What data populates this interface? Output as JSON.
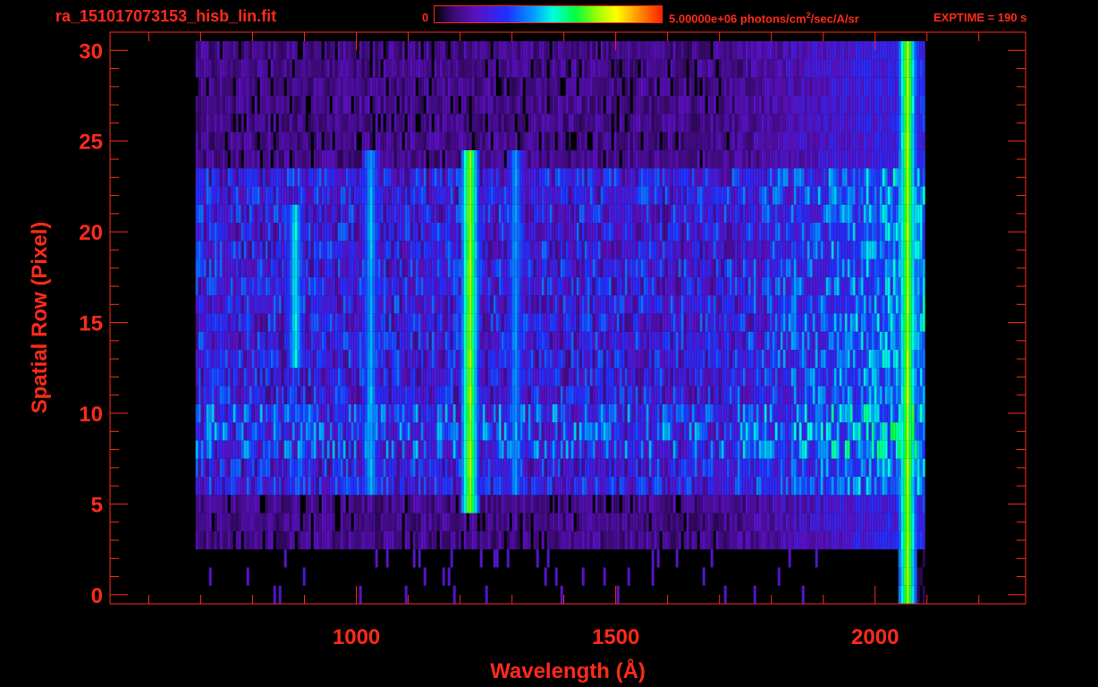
{
  "header": {
    "filename": "ra_151017073153_hisb_lin.fit",
    "colorbar_min_label": "0",
    "colorbar_max_label_prefix": "5.00000e+06 photons/cm",
    "colorbar_max_label_sup": "2",
    "colorbar_max_label_suffix": "/sec/A/sr",
    "exptime_label": "EXPTIME = 190 s"
  },
  "colors": {
    "axis": "#ff2a1a",
    "background": "#000000"
  },
  "chart_data": {
    "type": "heatmap",
    "title": "",
    "xlabel": "Wavelength (Å)",
    "ylabel": "Spatial Row (Pixel)",
    "xlim": [
      525,
      2290
    ],
    "ylim": [
      -0.5,
      31
    ],
    "xticks": [
      1000,
      1500,
      2000
    ],
    "xtick_labels": [
      "1000",
      "1500",
      "2000"
    ],
    "yticks": [
      0,
      5,
      10,
      15,
      20,
      25,
      30
    ],
    "ytick_labels": [
      "0",
      "5",
      "10",
      "15",
      "20",
      "25",
      "30"
    ],
    "colorscale": "rainbow",
    "zlim": [
      0,
      5000000
    ],
    "zunits": "photons/cm^2/sec/A/sr",
    "data_x_range": [
      690,
      2095
    ],
    "data_y_range": [
      0,
      30
    ],
    "emission_lines": [
      {
        "wavelength": 1216,
        "rows": [
          5,
          24
        ],
        "intensity": 0.72
      },
      {
        "wavelength": 1025,
        "rows": [
          6,
          24
        ],
        "intensity": 0.45
      },
      {
        "wavelength": 880,
        "rows": [
          13,
          21
        ],
        "intensity": 0.5
      },
      {
        "wavelength": 1304,
        "rows": [
          6,
          24
        ],
        "intensity": 0.42
      },
      {
        "wavelength": 2060,
        "rows": [
          0,
          30
        ],
        "intensity": 0.72
      }
    ],
    "grid": false
  }
}
